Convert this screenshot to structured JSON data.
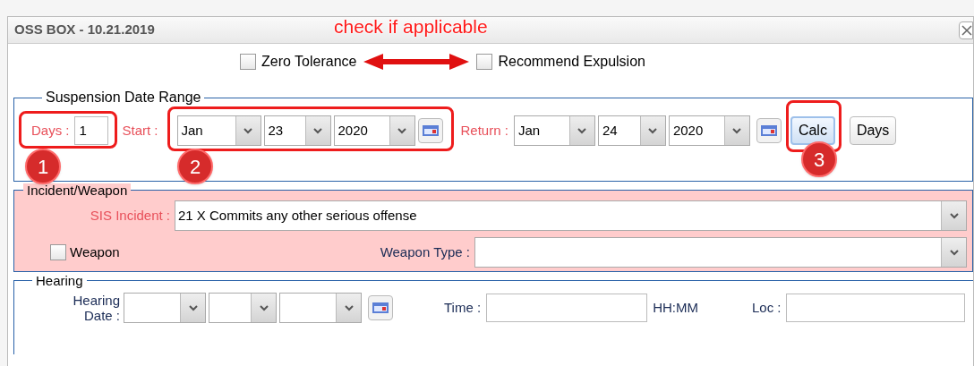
{
  "window": {
    "title": "OSS BOX - 10.21.2019"
  },
  "annotations": {
    "note": "check if applicable",
    "markers": [
      "1",
      "2",
      "3"
    ]
  },
  "flags": [
    {
      "label": "Zero Tolerance",
      "checked": false
    },
    {
      "label": "Recommend Expulsion",
      "checked": false
    }
  ],
  "suspension": {
    "legend": "Suspension Date Range",
    "days": {
      "label": "Days :",
      "value": "1"
    },
    "start": {
      "label": "Start :",
      "month": "Jan",
      "day": "23",
      "year": "2020"
    },
    "return": {
      "label": "Return :",
      "month": "Jan",
      "day": "24",
      "year": "2020"
    },
    "buttons": [
      {
        "label": "Calc",
        "focused": true
      },
      {
        "label": "Days",
        "focused": false
      }
    ]
  },
  "incident": {
    "legend": "Incident/Weapon",
    "sis_incident": {
      "label": "SIS Incident :",
      "value": "21 X Commits any other serious offense"
    },
    "weapon": {
      "label": "Weapon",
      "checked": false
    },
    "weapon_type": {
      "label": "Weapon Type :"
    }
  },
  "hearing": {
    "legend": "Hearing",
    "date_label": "Hearing Date :",
    "time_label": "Time :",
    "time_format": "HH:MM",
    "loc_label": "Loc :"
  }
}
